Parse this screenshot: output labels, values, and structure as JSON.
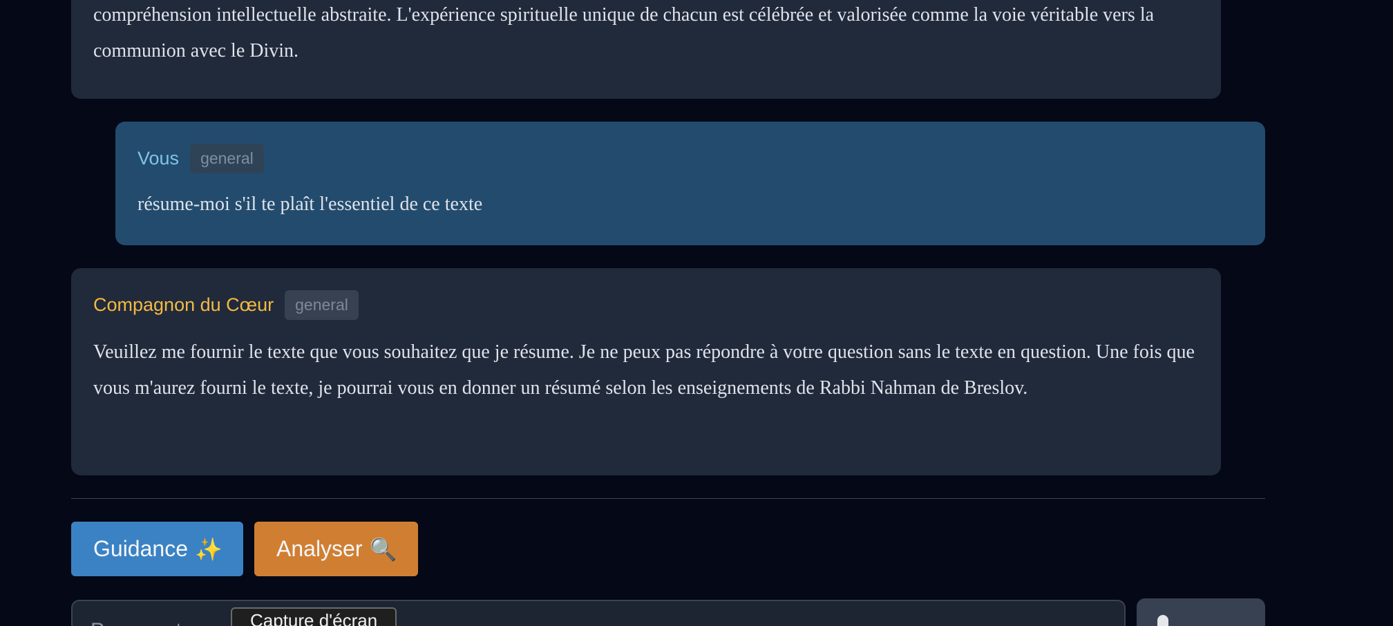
{
  "messages": {
    "previous": {
      "text": "compréhension intellectuelle abstraite. L'expérience spirituelle unique de chacun est célébrée et valorisée comme la voie véritable vers la communion avec le Divin."
    },
    "user": {
      "author": "Vous",
      "tag": "general",
      "text": "résume-moi s'il te plaît l'essentiel de ce texte"
    },
    "reply": {
      "author": "Compagnon du Cœur",
      "tag": "general",
      "text": "Veuillez me fournir le texte que vous souhaitez que je résume. Je ne peux pas répondre à votre question sans le texte en question. Une fois que vous m'aurez fourni le texte, je pourrai vous en donner un résumé selon les enseignements de Rabbi Nahman de Breslov."
    }
  },
  "actions": {
    "guidance_label": "Guidance",
    "guidance_icon": "✨",
    "analyser_label": "Analyser",
    "analyser_icon": "🔍"
  },
  "input": {
    "placeholder": "Posez votre",
    "tooltip": "Capture d'écran"
  },
  "colors": {
    "background": "#050816",
    "assistant_card": "#212a3b",
    "user_card": "#234b6d",
    "guidance_button": "#3b82c4",
    "analyser_button": "#d07f32",
    "user_name": "#7fc4ec",
    "bot_name": "#f4b942"
  }
}
